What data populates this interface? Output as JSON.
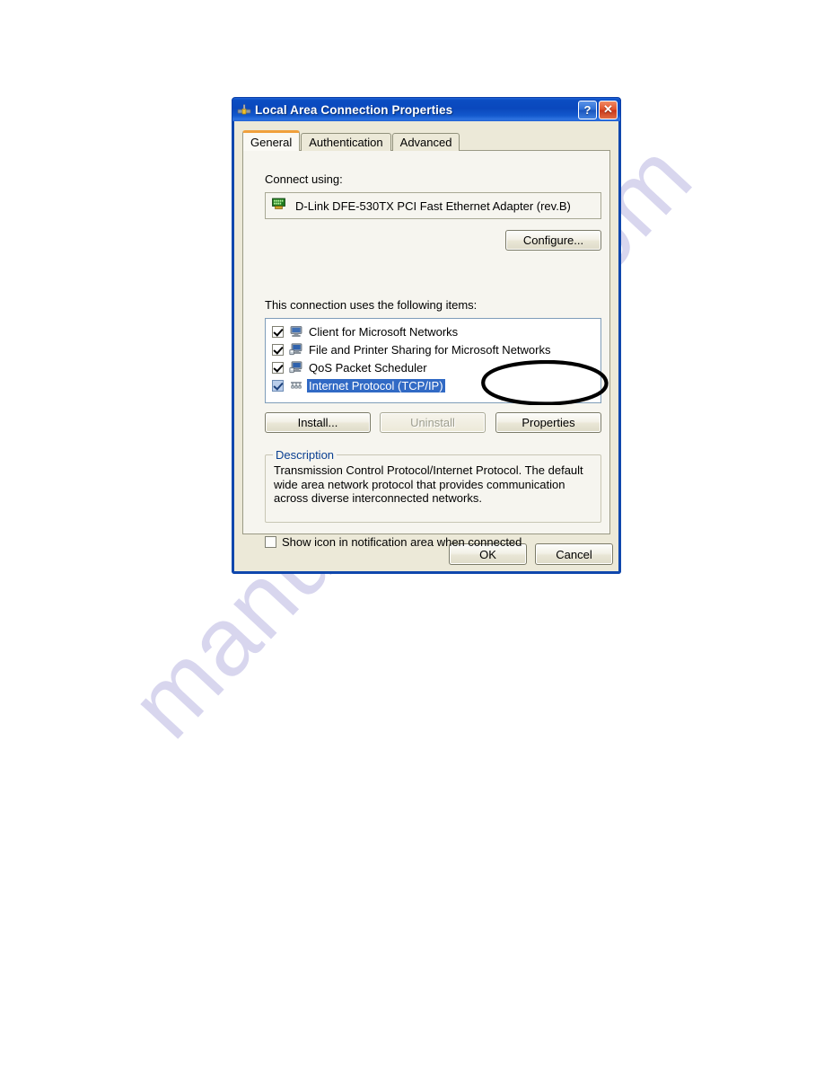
{
  "watermark": {
    "text": "manualshive.com"
  },
  "dialog": {
    "title": "Local Area Connection Properties",
    "title_icon": "network-connection-icon",
    "titlebar_buttons": [
      {
        "name": "help-button",
        "glyph": "?"
      },
      {
        "name": "close-button",
        "glyph": "✕"
      }
    ],
    "tabs": [
      {
        "label": "General",
        "active": true
      },
      {
        "label": "Authentication",
        "active": false
      },
      {
        "label": "Advanced",
        "active": false
      }
    ],
    "general": {
      "connect_using_label": "Connect using:",
      "adapter": {
        "icon": "network-card-icon",
        "name": "D-Link DFE-530TX PCI Fast Ethernet Adapter (rev.B)"
      },
      "configure_button": "Configure...",
      "items_label": "This connection uses the following items:",
      "items": [
        {
          "label": "Client for Microsoft Networks",
          "checked": true,
          "selected": false,
          "icon": "client-computer-icon"
        },
        {
          "label": "File and Printer Sharing for Microsoft Networks",
          "checked": true,
          "selected": false,
          "icon": "file-sharing-icon"
        },
        {
          "label": "QoS Packet Scheduler",
          "checked": true,
          "selected": false,
          "icon": "qos-scheduler-icon"
        },
        {
          "label": "Internet Protocol (TCP/IP)",
          "checked": true,
          "selected": true,
          "icon": "protocol-icon"
        }
      ],
      "buttons": {
        "install": "Install...",
        "uninstall": "Uninstall",
        "properties": "Properties"
      },
      "description_group_title": "Description",
      "description_text": "Transmission Control Protocol/Internet Protocol. The default wide area network protocol that provides communication across diverse interconnected networks.",
      "show_icon_checkbox": {
        "label": "Show icon in notification area when connected",
        "checked": false
      }
    },
    "footer_buttons": {
      "ok": "OK",
      "cancel": "Cancel"
    }
  },
  "annotation": {
    "type": "hand-drawn-ellipse",
    "targets": "properties-button",
    "color": "#000000"
  },
  "colors": {
    "titlebar_blue": "#0a48bd",
    "dialog_face": "#ece9d8",
    "tab_panel": "#f6f5ef",
    "selection_blue": "#316ac5",
    "group_label_blue": "#0a3f91",
    "active_tab_accent": "#f0a03c",
    "watermark": "#d6d4ee"
  }
}
